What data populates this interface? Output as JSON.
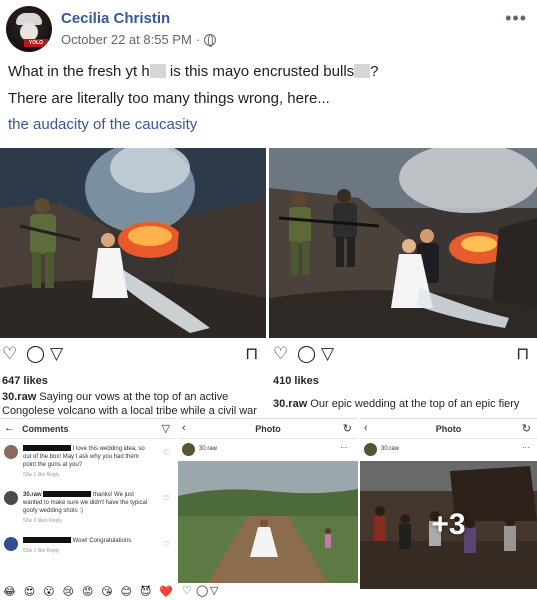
{
  "post": {
    "author": "Cecilia Christin",
    "timestamp": "October 22 at 8:55 PM",
    "separator": "·",
    "privacy_icon": "globe-icon",
    "more_icon": "ellipsis-icon",
    "text_line1_part1": "What in the fresh yt h",
    "text_line1_part2": " is this mayo encrusted bulls",
    "text_line1_part3": "?",
    "text_line2": "There are literally too many things wrong, here...",
    "text_line3": "the audacity of the caucasity"
  },
  "instagram_left": {
    "likes": "647 likes",
    "caption_user": "30.raw",
    "caption_line1": " Saying our vows at the top of an active",
    "caption_line2": "Congolese volcano with a local tribe while a civil war"
  },
  "instagram_right": {
    "likes": "410 likes",
    "caption_user": "30.raw",
    "caption_line1": " Our epic wedding at the top of an epic fiery"
  },
  "comments_panel": {
    "title": "Comments",
    "back_icon": "back-arrow-icon",
    "send_icon": "send-icon",
    "comments": [
      {
        "text": "I love this wedding idea, so out of the box! May I ask why you had them point the guns at you?",
        "meta": "52w   1 like   Reply"
      },
      {
        "user": "30.raw",
        "text": " thanks! We just wanted to make sure we didn't have the typical goofy wedding shots :)",
        "meta": "52w   3 likes   Reply"
      },
      {
        "text": "Wow! Congratulations",
        "meta": "52w   1 like   Reply"
      }
    ],
    "emojis": [
      "😂",
      "😍",
      "😮",
      "😢",
      "😡",
      "😘",
      "😊",
      "😈",
      "❤️"
    ]
  },
  "photo_panel_middle": {
    "title": "Photo",
    "username": "30.raw"
  },
  "photo_panel_right": {
    "title": "Photo",
    "username": "30.raw",
    "overlay": "+3"
  },
  "colors": {
    "link_blue": "#385898",
    "text": "#1c1e21",
    "meta_gray": "#606770"
  }
}
